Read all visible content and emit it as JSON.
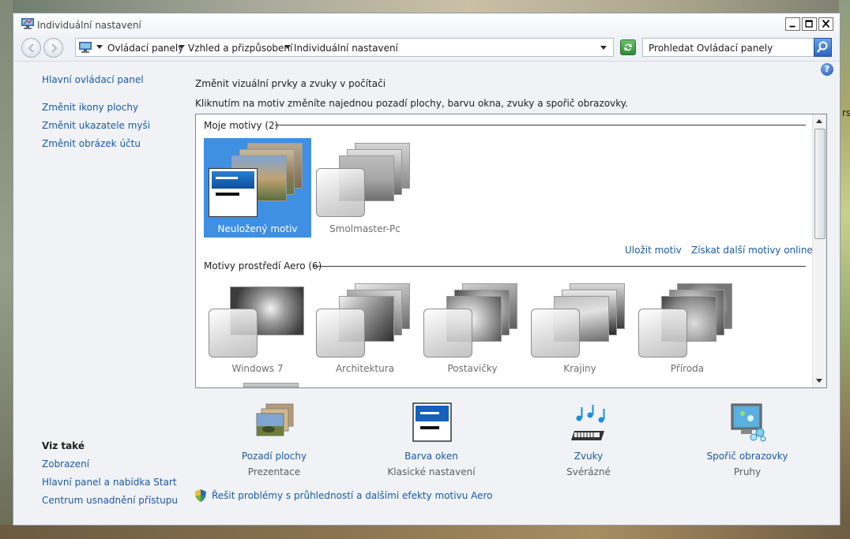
{
  "window": {
    "title": "Individuální nastavení",
    "controls": {
      "minimize": "minimize",
      "maximize": "maximize",
      "close": "close"
    }
  },
  "address": {
    "breadcrumbs": [
      "Ovládací panely",
      "Vzhled a přizpůsobení",
      "Individuální nastavení"
    ],
    "search_placeholder": "Prohledat Ovládací panely"
  },
  "sidebar": {
    "home": "Hlavní ovládací panel",
    "links": [
      "Změnit ikony plochy",
      "Změnit ukazatele myši",
      "Změnit obrázek účtu"
    ],
    "see_also_title": "Viz také",
    "see_also": [
      "Zobrazení",
      "Hlavní panel a nabídka Start",
      "Centrum usnadnění přístupu"
    ]
  },
  "main": {
    "heading": "Změnit vizuální prvky a zvuky v počítači",
    "subheading": "Kliknutím na motiv změníte najednou pozadí plochy, barvu okna, zvuky a spořič obrazovky.",
    "my_themes_title": "Moje motivy (2)",
    "my_themes": [
      "Neuložený motiv",
      "Smolmaster-Pc"
    ],
    "save_theme": "Uložit motiv",
    "get_more": "Získat další motivy online",
    "aero_title": "Motivy prostředí Aero (6)",
    "aero_themes": [
      "Windows 7",
      "Architektura",
      "Postavičky",
      "Krajiny",
      "Příroda"
    ]
  },
  "bottom": [
    {
      "title": "Pozadí plochy",
      "sub": "Prezentace",
      "icon": "desktop-background-icon"
    },
    {
      "title": "Barva oken",
      "sub": "Klasické nastavení",
      "icon": "window-color-icon"
    },
    {
      "title": "Zvuky",
      "sub": "Svérázné",
      "icon": "sounds-icon"
    },
    {
      "title": "Spořič obrazovky",
      "sub": "Pruhy",
      "icon": "screensaver-icon"
    }
  ],
  "troubleshoot": "Řešit problémy s průhledností a dalšími efekty motivu Aero",
  "edge_text": "rs",
  "colors": {
    "link": "#1a5aa6",
    "selected": "#3f8fe3"
  }
}
